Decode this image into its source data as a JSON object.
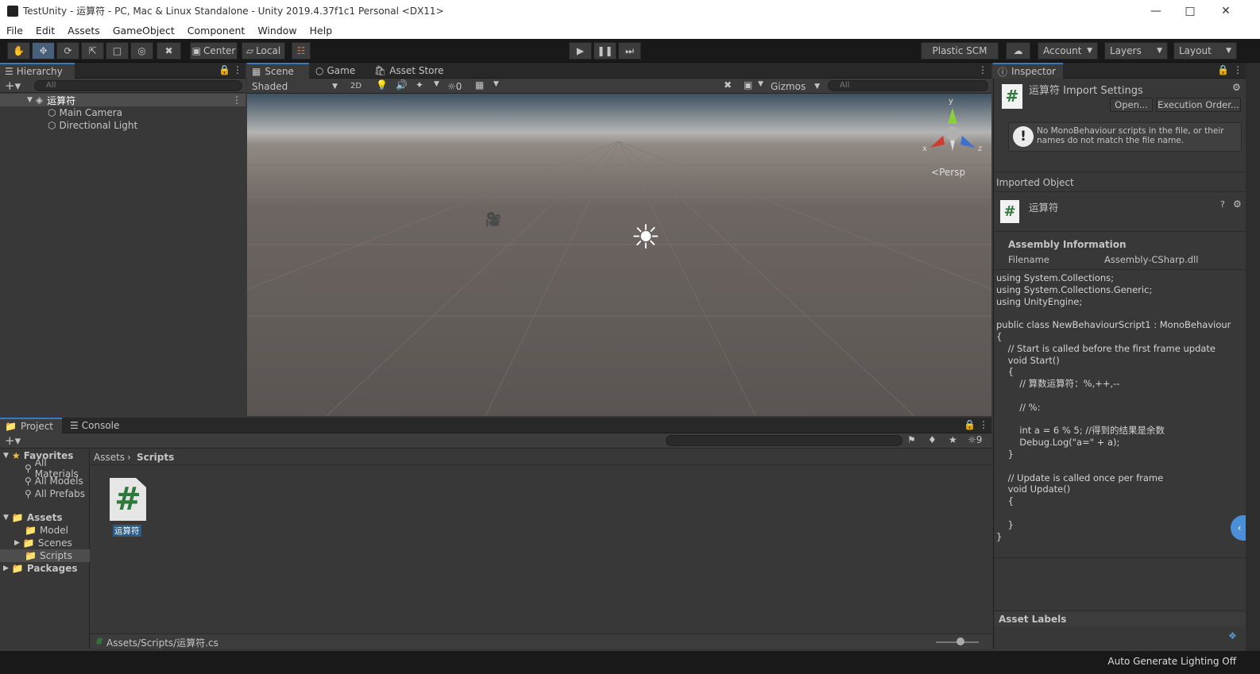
{
  "window": {
    "title": "TestUnity - 运算符 - PC, Mac & Linux Standalone - Unity 2019.4.37f1c1 Personal <DX11>"
  },
  "menu": [
    "File",
    "Edit",
    "Assets",
    "GameObject",
    "Component",
    "Window",
    "Help"
  ],
  "toolbar": {
    "center_label": "Center",
    "local_label": "Local",
    "plastic_label": "Plastic SCM",
    "account_label": "Account",
    "layers_label": "Layers",
    "layout_label": "Layout"
  },
  "hierarchy": {
    "tab": "Hierarchy",
    "search_placeholder": "All",
    "scene_name": "运算符",
    "items": [
      "Main Camera",
      "Directional Light"
    ]
  },
  "scene": {
    "tabs": [
      "Scene",
      "Game",
      "Asset Store"
    ],
    "shading": "Shaded",
    "mode_2d": "2D",
    "hidden_count": "0",
    "gizmos": "Gizmos",
    "search_placeholder": "All",
    "persp_label": "Persp",
    "axis_labels": {
      "x": "x",
      "y": "y",
      "z": "z"
    }
  },
  "inspector": {
    "tab": "Inspector",
    "header_title": "运算符 Import Settings",
    "open_btn": "Open...",
    "exec_btn": "Execution Order...",
    "warning": "No MonoBehaviour scripts in the file, or their names do not match the file name.",
    "imported_object": "Imported Object",
    "object_name": "运算符",
    "assembly_header": "Assembly Information",
    "filename_label": "Filename",
    "filename_value": "Assembly-CSharp.dll",
    "code": "using System.Collections;\nusing System.Collections.Generic;\nusing UnityEngine;\n\npublic class NewBehaviourScript1 : MonoBehaviour\n{\n    // Start is called before the first frame update\n    void Start()\n    {\n        // 算数运算符：%,++,--\n\n        // %:\n\n        int a = 6 % 5; //得到的结果是余数\n        Debug.Log(\"a=\" + a);\n    }\n\n    // Update is called once per frame\n    void Update()\n    {\n        \n    }\n}",
    "asset_labels": "Asset Labels"
  },
  "project": {
    "tabs": [
      "Project",
      "Console"
    ],
    "hidden_count": "9",
    "favorites": "Favorites",
    "fav_items": [
      "All Materials",
      "All Models",
      "All Prefabs"
    ],
    "assets": "Assets",
    "asset_items": [
      "Model",
      "Scenes",
      "Scripts"
    ],
    "packages": "Packages",
    "breadcrumb": [
      "Assets",
      "Scripts"
    ],
    "file_name": "运算符",
    "path": "Assets/Scripts/运算符.cs"
  },
  "status": {
    "text": "Auto Generate Lighting Off"
  },
  "colors": {
    "selection": "#2c5d87",
    "tab_accent": "#3a79bb",
    "script_green": "#2f7a3a"
  }
}
